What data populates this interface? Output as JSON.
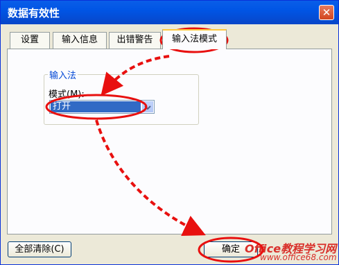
{
  "window": {
    "title": "数据有效性",
    "close_glyph": "✕"
  },
  "tabs": [
    {
      "label": "设置"
    },
    {
      "label": "输入信息"
    },
    {
      "label": "出错警告"
    },
    {
      "label": "输入法模式",
      "active": true
    }
  ],
  "group": {
    "title": "输入法",
    "mode_label": "模式(M):",
    "mode_value": "打开"
  },
  "buttons": {
    "clear_all": "全部清除(C)",
    "ok": "确定"
  },
  "watermark": {
    "brand": "Office教程学习网",
    "url": "www.office68.com"
  },
  "colors": {
    "accent": "#0055e5",
    "annotation": "#e8100f",
    "selection": "#316ac5"
  }
}
